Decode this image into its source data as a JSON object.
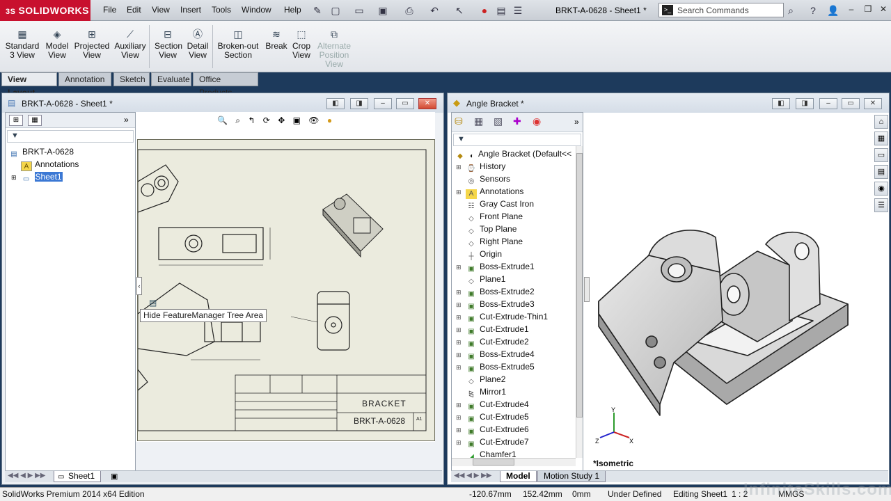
{
  "app": {
    "logo": "SOLIDWORKS",
    "menu": [
      "File",
      "Edit",
      "View",
      "Insert",
      "Tools",
      "Window",
      "Help"
    ],
    "doc_title": "BRKT-A-0628 - Sheet1 *",
    "search_placeholder": "Search Commands"
  },
  "command_manager": {
    "commands": [
      {
        "label1": "Standard",
        "label2": "3 View",
        "icon": "standard-3-view-icon",
        "enabled": true
      },
      {
        "label1": "Model",
        "label2": "View",
        "icon": "model-view-icon",
        "enabled": true
      },
      {
        "label1": "Projected",
        "label2": "View",
        "icon": "projected-view-icon",
        "enabled": true
      },
      {
        "label1": "Auxiliary",
        "label2": "View",
        "icon": "auxiliary-view-icon",
        "enabled": true
      },
      {
        "label1": "Section",
        "label2": "View",
        "icon": "section-view-icon",
        "enabled": true
      },
      {
        "label1": "Detail",
        "label2": "View",
        "icon": "detail-view-icon",
        "enabled": true
      },
      {
        "label1": "Broken-out",
        "label2": "Section",
        "icon": "broken-out-section-icon",
        "enabled": true
      },
      {
        "label1": "Break",
        "label2": "",
        "icon": "break-icon",
        "enabled": true
      },
      {
        "label1": "Crop",
        "label2": "View",
        "icon": "crop-view-icon",
        "enabled": true
      },
      {
        "label1": "Alternate",
        "label2": "Position",
        "label3": "View",
        "icon": "alternate-position-view-icon",
        "enabled": false
      }
    ],
    "tabs": [
      "View Layout",
      "Annotation",
      "Sketch",
      "Evaluate",
      "Office Products"
    ],
    "active_tab": "View Layout"
  },
  "left_window": {
    "title": "BRKT-A-0628 - Sheet1 *",
    "tree": [
      {
        "label": "BRKT-A-0628",
        "icon": "drawing-icon",
        "indent": 0
      },
      {
        "label": "Annotations",
        "icon": "annotations-icon",
        "indent": 1
      },
      {
        "label": "Sheet1",
        "icon": "sheet-icon",
        "indent": 1,
        "selected": true
      }
    ],
    "tooltip": "Hide FeatureManager Tree Area",
    "title_block": {
      "name": "BRACKET",
      "number": "BRKT-A-0628",
      "rev": "A1"
    },
    "sheet_tab": "Sheet1"
  },
  "right_window": {
    "title": "Angle Bracket *",
    "root": "Angle Bracket  (Default<<",
    "tree": [
      {
        "label": "History",
        "icon": "history-icon",
        "exp": true
      },
      {
        "label": "Sensors",
        "icon": "sensors-icon",
        "exp": false
      },
      {
        "label": "Annotations",
        "icon": "annotations-icon",
        "exp": true
      },
      {
        "label": "Gray Cast Iron",
        "icon": "material-icon",
        "exp": false
      },
      {
        "label": "Front Plane",
        "icon": "plane-icon",
        "exp": false
      },
      {
        "label": "Top Plane",
        "icon": "plane-icon",
        "exp": false
      },
      {
        "label": "Right Plane",
        "icon": "plane-icon",
        "exp": false
      },
      {
        "label": "Origin",
        "icon": "origin-icon",
        "exp": false
      },
      {
        "label": "Boss-Extrude1",
        "icon": "feature-icon",
        "exp": true
      },
      {
        "label": "Plane1",
        "icon": "plane-icon",
        "exp": false
      },
      {
        "label": "Boss-Extrude2",
        "icon": "feature-icon",
        "exp": true
      },
      {
        "label": "Boss-Extrude3",
        "icon": "feature-icon",
        "exp": true
      },
      {
        "label": "Cut-Extrude-Thin1",
        "icon": "feature-icon",
        "exp": true
      },
      {
        "label": "Cut-Extrude1",
        "icon": "feature-icon",
        "exp": true
      },
      {
        "label": "Cut-Extrude2",
        "icon": "feature-icon",
        "exp": true
      },
      {
        "label": "Boss-Extrude4",
        "icon": "feature-icon",
        "exp": true
      },
      {
        "label": "Boss-Extrude5",
        "icon": "feature-icon",
        "exp": true
      },
      {
        "label": "Plane2",
        "icon": "plane-icon",
        "exp": false
      },
      {
        "label": "Mirror1",
        "icon": "mirror-icon",
        "exp": false
      },
      {
        "label": "Cut-Extrude4",
        "icon": "feature-icon",
        "exp": true
      },
      {
        "label": "Cut-Extrude5",
        "icon": "feature-icon",
        "exp": true
      },
      {
        "label": "Cut-Extrude6",
        "icon": "feature-icon",
        "exp": true
      },
      {
        "label": "Cut-Extrude7",
        "icon": "feature-icon",
        "exp": true
      },
      {
        "label": "Chamfer1",
        "icon": "chamfer-icon",
        "exp": false
      }
    ],
    "view_label": "*Isometric",
    "model_tabs": [
      "Model",
      "Motion Study 1"
    ],
    "active_model_tab": "Model"
  },
  "status": {
    "edition": "SolidWorks Premium 2014 x64 Edition",
    "x": "-120.67mm",
    "y": "152.42mm",
    "z": "0mm",
    "state": "Under Defined",
    "editing": "Editing Sheet1",
    "scale": "1 : 2",
    "units": "MMGS",
    "watermark": "InfiniteSkills.com"
  },
  "colors": {
    "accent": "#3b78d4",
    "brand": "#c8102e",
    "background": "#1d3a5c"
  }
}
